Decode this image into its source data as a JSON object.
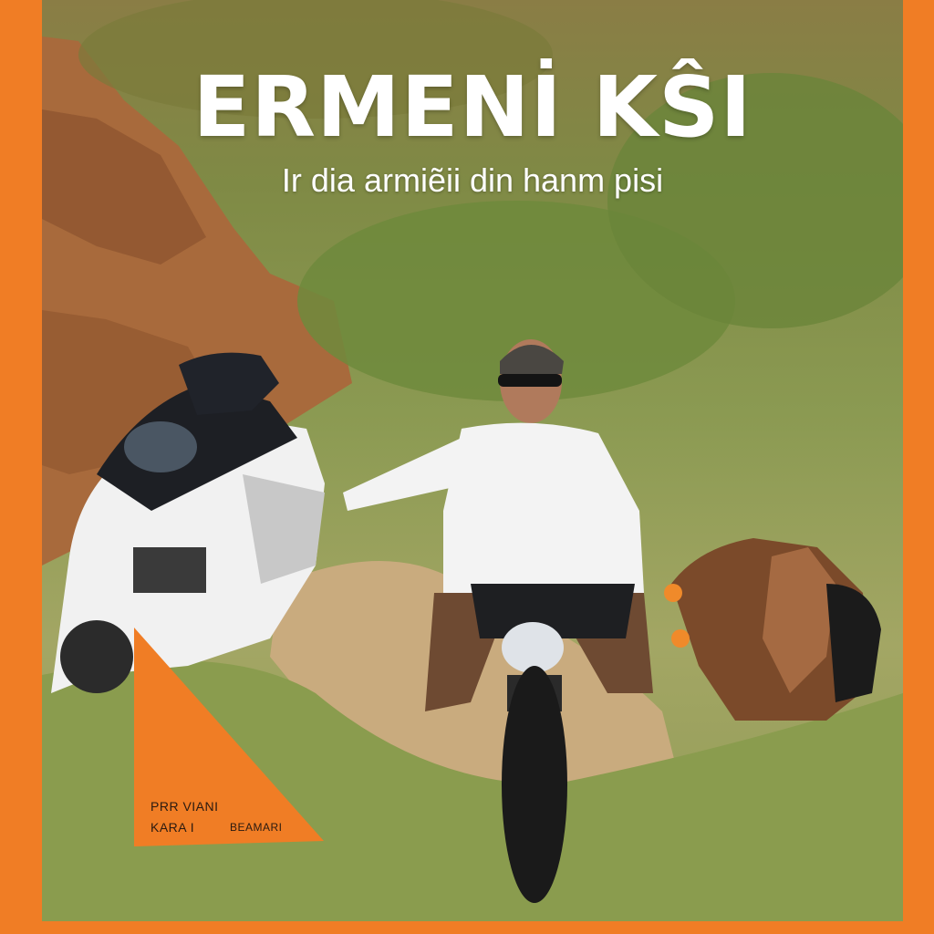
{
  "poster": {
    "title": "ERMENİ KŜI",
    "subtitle": "Ir dia armiẽii din hanm pisi",
    "badge": {
      "line1": "PRR VIANI",
      "line2a": "KARA I",
      "line2b": "BEAMARI"
    }
  },
  "colors": {
    "frame": "#f07d25",
    "title_text": "#ffffff",
    "badge_text": "#2a1a10"
  }
}
